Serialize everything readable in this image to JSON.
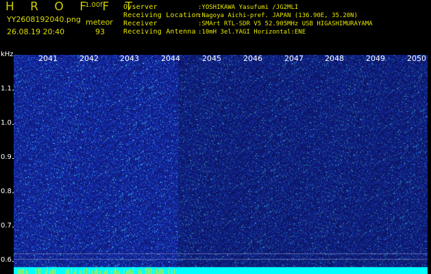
{
  "header": {
    "app_title": "H R O F F T",
    "app_version": "1.00f",
    "file_name": "YY2608192040.png",
    "date_time": "26.08.19 20:40",
    "meteor_label": "meteor",
    "meteor_count": "93"
  },
  "info": [
    {
      "label": "Ovserver",
      "value": ":YOSHIKAWA Yasufumi /JG2MLI"
    },
    {
      "label": "Receiving Location",
      "value": ":Nagoya Aichi-pref. JAPAN (136.90E, 35.20N)"
    },
    {
      "label": "Receiver",
      "value": ":SMArt RTL-SDR V5 52.905MHz USB HIGASHIMURAYAMA"
    },
    {
      "label": "Receiving Antenna",
      "value": ":10mH 3el.YAGI Horizontal:ENE"
    }
  ],
  "axis": {
    "y_unit": "kHz",
    "y_ticks": [
      "1.1",
      "1.0",
      "0.9",
      "0.8",
      "0.7",
      "0.6"
    ],
    "x_ticks": [
      "2041",
      "2042",
      "2043",
      "2044",
      "2045",
      "2046",
      "2047",
      "2048",
      "2049",
      "2050"
    ]
  },
  "colors": {
    "background": "#000000",
    "header_text": "#e8e800",
    "spectrogram_base": "#1a2fb0",
    "noise_highlight": "#33ccff",
    "bottom_band": "#00ffff"
  }
}
